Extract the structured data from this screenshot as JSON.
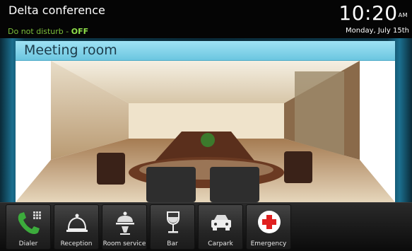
{
  "header": {
    "title": "Delta conference",
    "dnd_label": "Do not disturb - ",
    "dnd_state": "OFF",
    "time": "10:20",
    "ampm": "AM",
    "date": "Monday, July 15th"
  },
  "room": {
    "title": "Meeting room"
  },
  "dock": {
    "items": [
      {
        "label": "Dialer",
        "icon": "phone-keypad-icon",
        "color": "#3cab3c"
      },
      {
        "label": "Reception",
        "icon": "service-bell-icon"
      },
      {
        "label": "Room service",
        "icon": "cloche-tray-icon"
      },
      {
        "label": "Bar",
        "icon": "wine-glass-icon"
      },
      {
        "label": "Carpark",
        "icon": "car-icon"
      },
      {
        "label": "Emergency",
        "icon": "red-cross-icon",
        "color": "#e02020"
      }
    ]
  }
}
